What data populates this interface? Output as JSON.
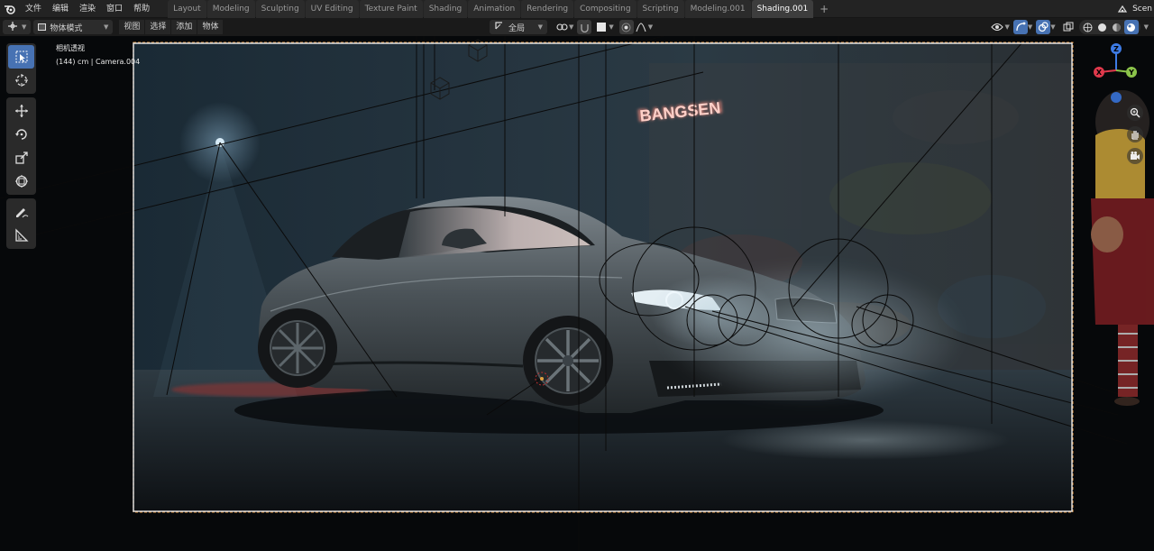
{
  "topbar": {
    "menus": [
      "文件",
      "编辑",
      "渲染",
      "窗口",
      "帮助"
    ],
    "tabs": [
      {
        "label": "Layout",
        "active": false
      },
      {
        "label": "Modeling",
        "active": false
      },
      {
        "label": "Sculpting",
        "active": false
      },
      {
        "label": "UV Editing",
        "active": false
      },
      {
        "label": "Texture Paint",
        "active": false
      },
      {
        "label": "Shading",
        "active": false
      },
      {
        "label": "Animation",
        "active": false
      },
      {
        "label": "Rendering",
        "active": false
      },
      {
        "label": "Compositing",
        "active": false
      },
      {
        "label": "Scripting",
        "active": false
      },
      {
        "label": "Modeling.001",
        "active": false
      },
      {
        "label": "Shading.001",
        "active": true
      }
    ],
    "add_tab": "+",
    "scene_label": "Scen"
  },
  "header": {
    "mode": "物体模式",
    "menus": [
      "视图",
      "选择",
      "添加",
      "物体"
    ],
    "orientation": "全局"
  },
  "viewport": {
    "camera_mode": "相机透视",
    "camera_info": "(144) cm | Camera.004",
    "neon_sign": "BANGSEN"
  },
  "gizmo": {
    "x": "X",
    "y": "Y",
    "z": "Z"
  },
  "colors": {
    "accent": "#4772b3",
    "axis_x": "#e0394c",
    "axis_y": "#8bc34a",
    "axis_z": "#3d7be5",
    "neon": "#ff8a80",
    "camera_frame": "#e0913a"
  }
}
